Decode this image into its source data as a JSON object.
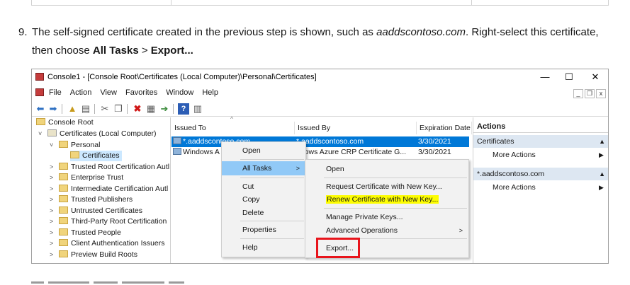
{
  "step": {
    "number": "9.",
    "text_before": "The self-signed certificate created in the previous step is shown, such as ",
    "text_italic": "aaddscontoso.com",
    "text_mid": ". Right-select this certificate, then choose ",
    "bold_all_tasks": "All Tasks",
    "arrow": " > ",
    "bold_export": "Export..."
  },
  "window": {
    "title": "Console1 - [Console Root\\Certificates (Local Computer)\\Personal\\Certificates]",
    "minimize": "—",
    "maximize": "☐",
    "close": "✕",
    "menu": [
      "File",
      "Action",
      "View",
      "Favorites",
      "Window",
      "Help"
    ],
    "mdi": [
      "_",
      "❐",
      "x"
    ]
  },
  "tree": [
    {
      "label": "Console Root",
      "chev": ""
    },
    {
      "label": "Certificates (Local Computer)",
      "chev": "˅"
    },
    {
      "label": "Personal",
      "chev": "˅"
    },
    {
      "label": "Certificates",
      "chev": ""
    },
    {
      "label": "Trusted Root Certification Autl",
      "chev": ">"
    },
    {
      "label": "Enterprise Trust",
      "chev": ">"
    },
    {
      "label": "Intermediate Certification Autl",
      "chev": ">"
    },
    {
      "label": "Trusted Publishers",
      "chev": ">"
    },
    {
      "label": "Untrusted Certificates",
      "chev": ">"
    },
    {
      "label": "Third-Party Root Certification",
      "chev": ">"
    },
    {
      "label": "Trusted People",
      "chev": ">"
    },
    {
      "label": "Client Authentication Issuers",
      "chev": ">"
    },
    {
      "label": "Preview Build Roots",
      "chev": ">"
    }
  ],
  "list": {
    "headers": [
      "Issued To",
      "Issued By",
      "Expiration Date"
    ],
    "rows": [
      {
        "issued_to": "*.aaddscontoso.com",
        "issued_by": "*.aaddscontoso.com",
        "expires": "3/30/2021"
      },
      {
        "issued_to": "Windows A",
        "issued_by": "ndows Azure CRP Certificate G...",
        "expires": "3/30/2021"
      }
    ]
  },
  "actions": {
    "title": "Actions",
    "sections": [
      {
        "label": "Certificates",
        "item": "More Actions"
      },
      {
        "label": "*.aaddscontoso.com",
        "item": "More Actions"
      }
    ]
  },
  "menu1": {
    "open": "Open",
    "all_tasks": "All Tasks",
    "cut": "Cut",
    "copy": "Copy",
    "delete": "Delete",
    "properties": "Properties",
    "help": "Help"
  },
  "menu2": {
    "open": "Open",
    "request_new_key": "Request Certificate with New Key...",
    "renew_new_key": "Renew Certificate with New Key...",
    "manage_keys": "Manage Private Keys...",
    "advanced": "Advanced Operations",
    "export": "Export..."
  },
  "colors": {
    "selection": "#0078d7",
    "menu_highlight": "#91c9f7",
    "callout_box": "#e8141b",
    "marker": "#fdfd00"
  }
}
